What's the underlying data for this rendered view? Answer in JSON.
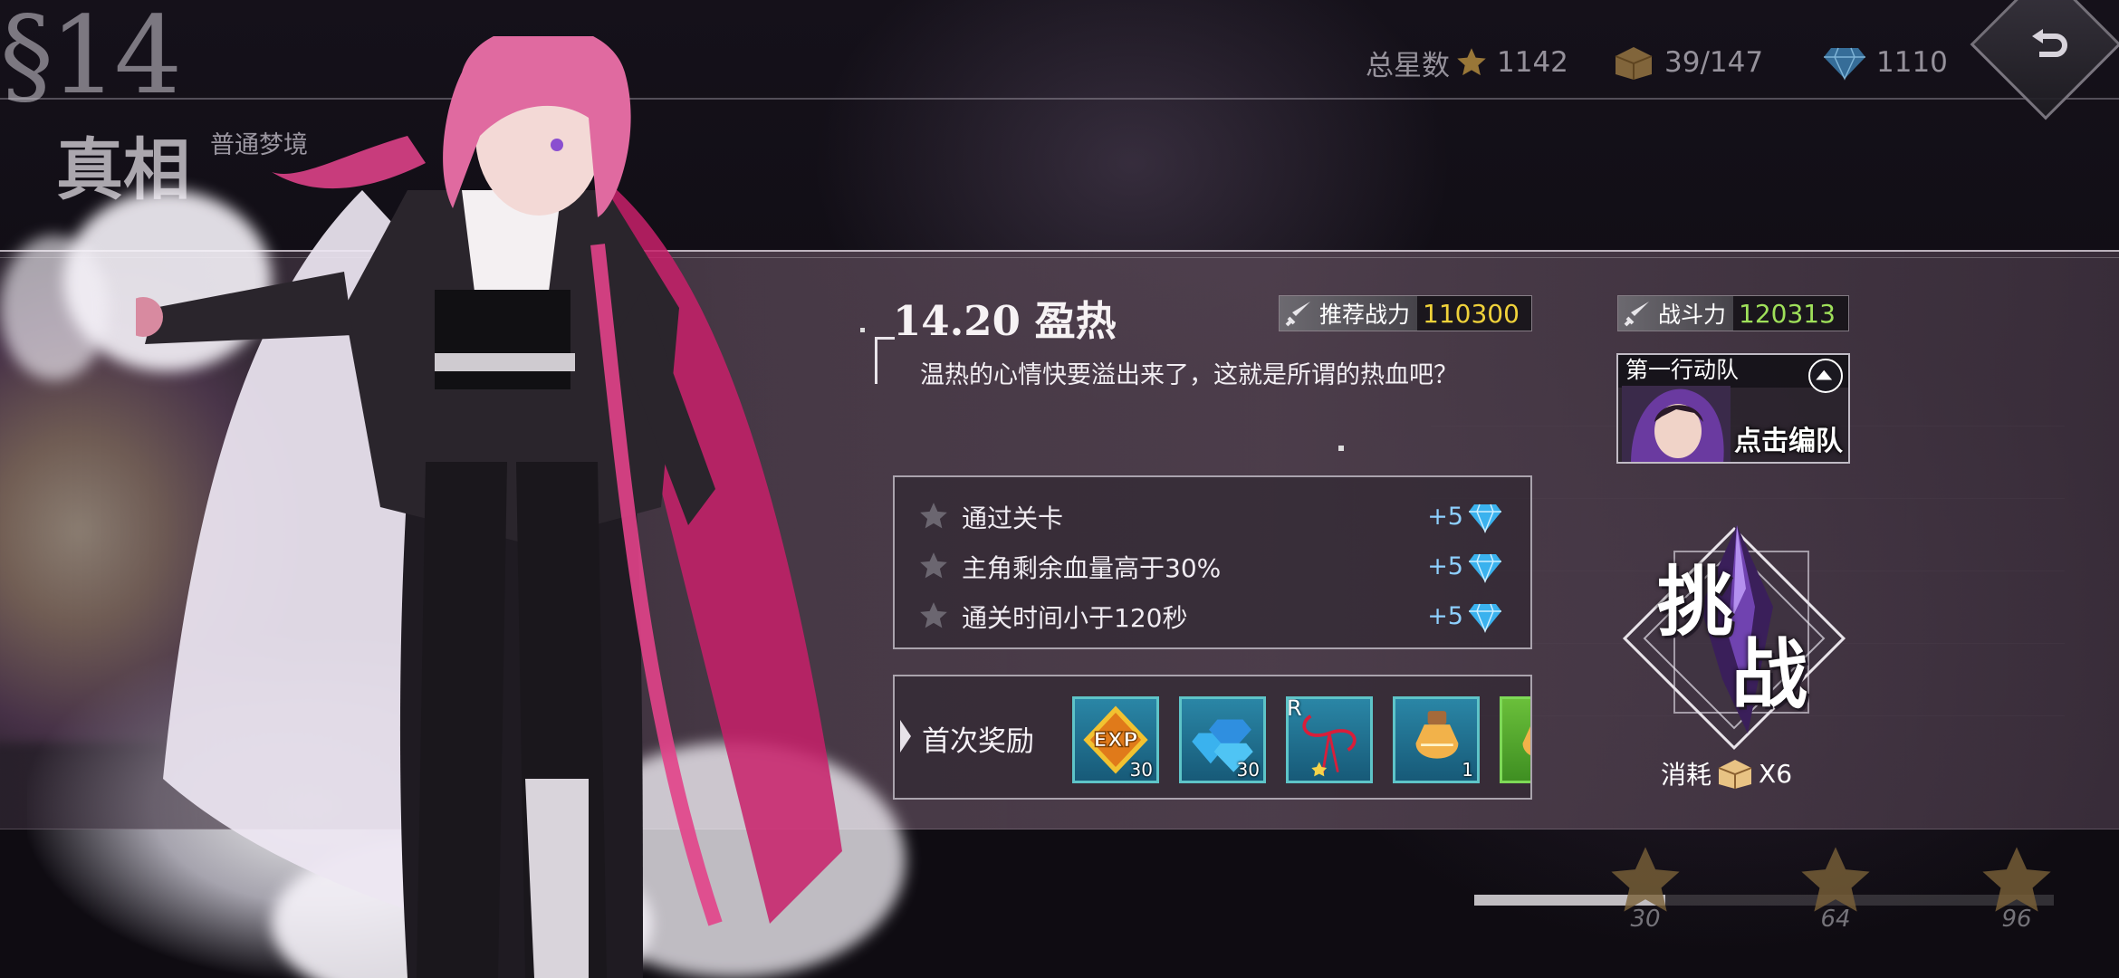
{
  "header": {
    "chapter_number": "§14",
    "stage_name": "真相",
    "difficulty": "普通梦境",
    "total_stars_label": "总星数",
    "total_stars": "1142",
    "chests": "39/147",
    "gems": "1110"
  },
  "stage": {
    "title": "14.20 盈热",
    "description": "温热的心情快要溢出来了，这就是所谓的热血吧？",
    "recommended_power_label": "推荐战力",
    "recommended_power": "110300",
    "power_label": "战斗力",
    "power": "120313"
  },
  "team": {
    "name": "第一行动队",
    "edit_label": "点击编队"
  },
  "conditions": [
    {
      "text": "通过关卡",
      "reward": "+5"
    },
    {
      "text": "主角剩余血量高于30%",
      "reward": "+5"
    },
    {
      "text": "通关时间小于120秒",
      "reward": "+5"
    }
  ],
  "first_rewards": {
    "label": "首次奖励",
    "items": [
      {
        "icon": "exp-icon",
        "count": "30"
      },
      {
        "icon": "gems-icon",
        "count": "30"
      },
      {
        "icon": "red-string-icon",
        "count": "",
        "badge": "R"
      },
      {
        "icon": "potion-icon",
        "count": "1"
      },
      {
        "icon": "potion-icon",
        "count": ""
      }
    ]
  },
  "challenge": {
    "char1": "挑",
    "char2": "战",
    "cost_label": "消耗",
    "cost_value": "X6"
  },
  "progress": {
    "fraction": 0.33,
    "milestones": [
      "30",
      "64",
      "96"
    ]
  },
  "colors": {
    "recommended_power": "#f0d23a",
    "power": "#9fe05a",
    "gem_reward": "#8ed0ff"
  }
}
